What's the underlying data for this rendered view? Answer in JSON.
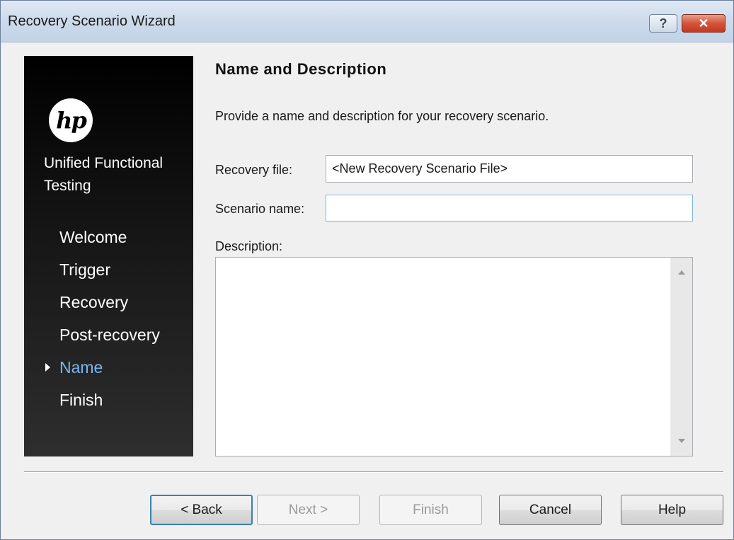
{
  "window": {
    "title": "Recovery Scenario Wizard",
    "help_glyph": "?",
    "close_glyph": "✕"
  },
  "sidebar": {
    "logo_text": "hp",
    "product_name": "Unified Functional Testing",
    "steps": [
      {
        "label": "Welcome"
      },
      {
        "label": "Trigger"
      },
      {
        "label": "Recovery"
      },
      {
        "label": "Post-recovery"
      },
      {
        "label": "Name"
      },
      {
        "label": "Finish"
      }
    ],
    "current_step": "Name",
    "current_color": "#7ab4f0"
  },
  "main": {
    "heading": "Name and Description",
    "instruction": "Provide a name and description for your recovery scenario.",
    "recovery_file": {
      "label": "Recovery file:",
      "value": "<New Recovery Scenario File>"
    },
    "scenario_name": {
      "label": "Scenario name:",
      "value": ""
    },
    "description": {
      "label": "Description:",
      "value": ""
    }
  },
  "buttons": {
    "back": "< Back",
    "next": "Next >",
    "finish": "Finish",
    "cancel": "Cancel",
    "help": "Help"
  }
}
